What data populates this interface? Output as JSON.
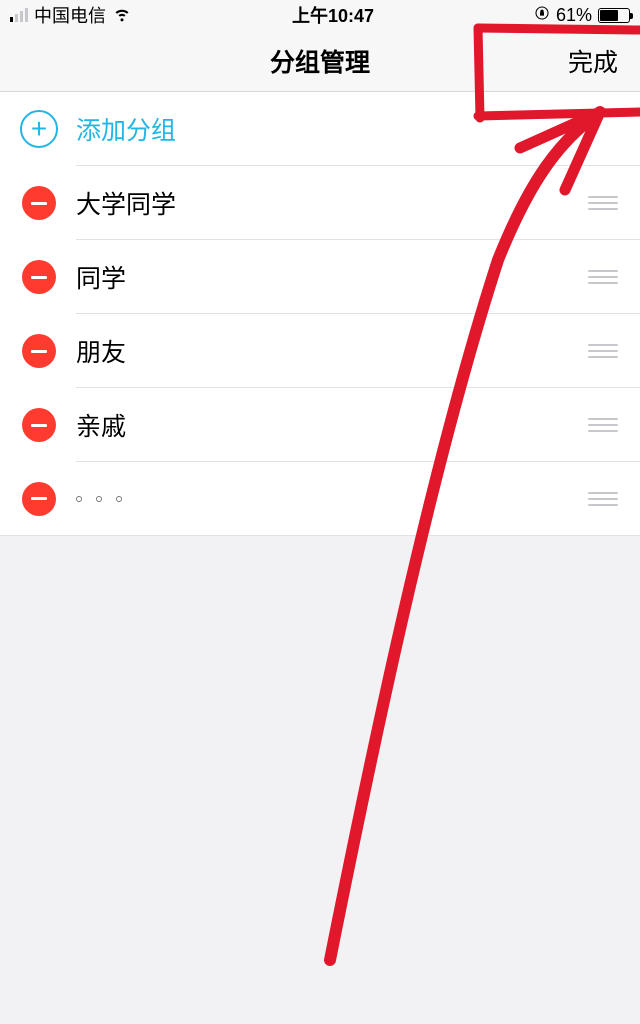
{
  "statusbar": {
    "carrier": "中国电信",
    "time": "上午10:47",
    "battery_text": "61%",
    "battery_level": 61
  },
  "nav": {
    "title": "分组管理",
    "done": "完成"
  },
  "add_row": {
    "label": "添加分组"
  },
  "groups": [
    {
      "label": "大学同学"
    },
    {
      "label": "同学"
    },
    {
      "label": "朋友"
    },
    {
      "label": "亲戚"
    }
  ],
  "colors": {
    "accent_cyan": "#22b6e7",
    "delete_red": "#ff3b30"
  }
}
